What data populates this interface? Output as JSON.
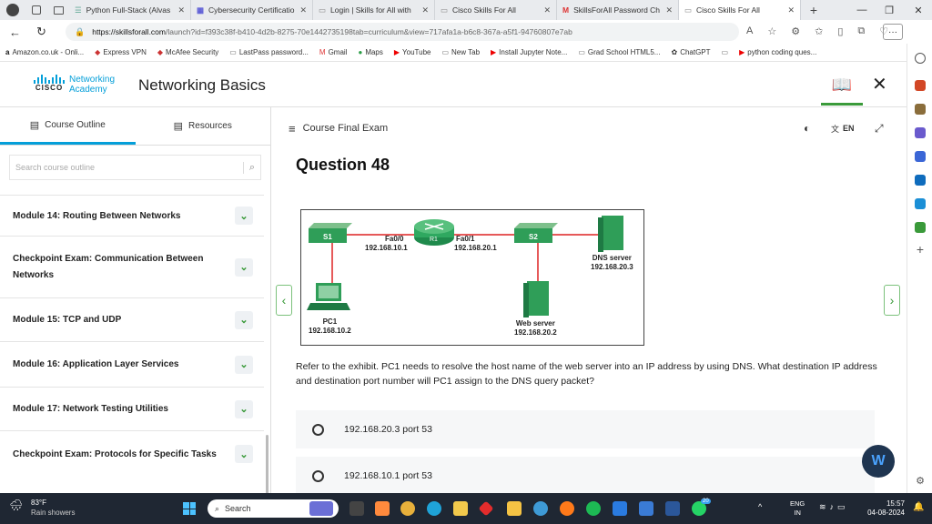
{
  "browser": {
    "tabs": [
      {
        "title": "Python Full-Stack (Alvas",
        "active": false
      },
      {
        "title": "Cybersecurity Certificatio",
        "active": false
      },
      {
        "title": "Login | Skills for All with",
        "active": false
      },
      {
        "title": "Cisco Skills For All",
        "active": false
      },
      {
        "title": "SkillsForAll Password Ch",
        "active": false
      },
      {
        "title": "Cisco Skills For All",
        "active": true
      }
    ],
    "url_host": "https://skillsforall.com",
    "url_path": "/launch?id=f393c38f-b410-4d2b-8275-70e1442735198tab=curriculum&view=717afa1a-b6c8-367a-a5f1-94760807e7ab",
    "bookmarks": [
      "Amazon.co.uk - Onli...",
      "Express VPN",
      "McAfee Security",
      "LastPass password...",
      "Gmail",
      "Maps",
      "YouTube",
      "New Tab",
      "Install Jupyter Note...",
      "Grad School HTML5...",
      "ChatGPT",
      "python coding ques..."
    ]
  },
  "header": {
    "logo_line1": "Networking",
    "logo_line2": "Academy",
    "logo_cisco": "CISCO",
    "course_title": "Networking Basics"
  },
  "sidebar": {
    "tab_outline": "Course Outline",
    "tab_resources": "Resources",
    "search_placeholder": "Search course outline",
    "modules": [
      "Module 14: Routing Between Networks",
      "Checkpoint Exam: Communication Between Networks",
      "Module 15: TCP and UDP",
      "Module 16: Application Layer Services",
      "Module 17: Network Testing Utilities",
      "Checkpoint Exam: Protocols for Specific Tasks"
    ]
  },
  "main": {
    "section_title": "Course Final Exam",
    "lang": "EN",
    "question_title": "Question 48",
    "question_text": "Refer to the exhibit. PC1 needs to resolve the host name of the web server into an IP address by using DNS. What destination IP address and destination port number will PC1 assign to the DNS query packet?",
    "options": [
      "192.168.20.3 port 53",
      "192.168.10.1 port 53"
    ],
    "exhibit": {
      "s1": "S1",
      "r1": "R1",
      "s2": "S2",
      "fa00": "Fa0/0",
      "fa00_ip": "192.168.10.1",
      "fa01": "Fa0/1",
      "fa01_ip": "192.168.20.1",
      "dns_name": "DNS server",
      "dns_ip": "192.168.20.3",
      "pc_name": "PC1",
      "pc_ip": "192.168.10.2",
      "web_name": "Web server",
      "web_ip": "192.168.20.2"
    }
  },
  "taskbar": {
    "weather_temp": "83°F",
    "weather_desc": "Rain showers",
    "search": "Search",
    "lang_line1": "ENG",
    "lang_line2": "IN",
    "time": "15:57",
    "date": "04-08-2024",
    "badge": "20"
  }
}
